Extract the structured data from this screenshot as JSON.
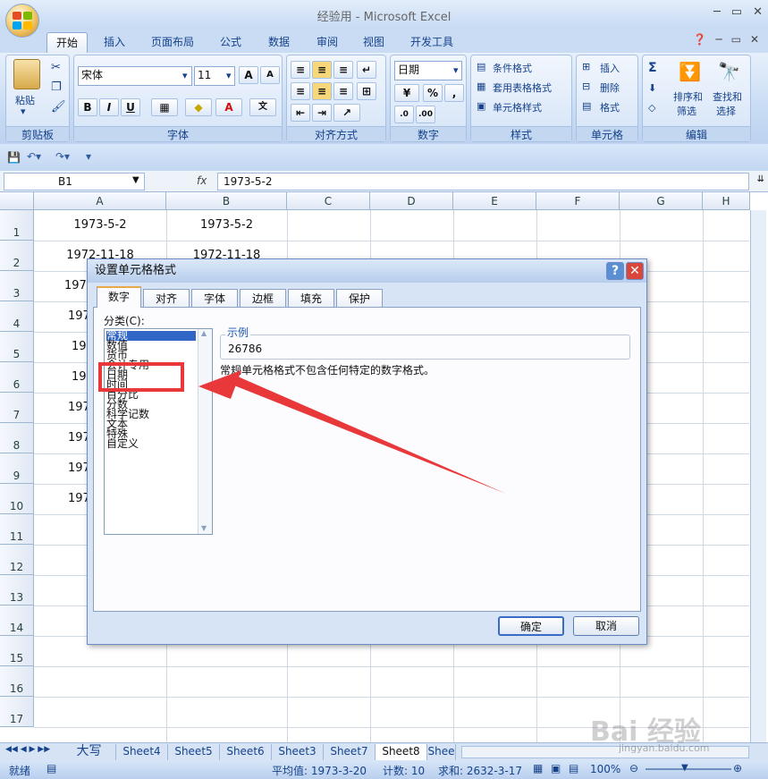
{
  "window": {
    "title": "经验用 - Microsoft Excel"
  },
  "ribbon_tabs": [
    "开始",
    "插入",
    "页面布局",
    "公式",
    "数据",
    "审阅",
    "视图",
    "开发工具"
  ],
  "ribbon": {
    "clipboard": {
      "paste": "粘贴",
      "label": "剪贴板"
    },
    "font": {
      "name": "宋体",
      "size": "11",
      "label": "字体",
      "bold": "B",
      "italic": "I",
      "underline": "U",
      "grow": "A",
      "shrink": "A",
      "color": "A"
    },
    "align": {
      "label": "对齐方式"
    },
    "number": {
      "format": "日期",
      "percent": "%",
      "comma": ",",
      "label": "数字"
    },
    "styles": {
      "cond": "条件格式",
      "table": "套用表格格式",
      "cell": "单元格样式",
      "label": "样式"
    },
    "cells": {
      "insert": "插入",
      "delete": "删除",
      "format": "格式",
      "label": "单元格"
    },
    "edit": {
      "sort_l1": "排序和",
      "sort_l2": "筛选",
      "find_l1": "查找和",
      "find_l2": "选择",
      "label": "编辑",
      "sum": "Σ"
    }
  },
  "formula_bar": {
    "name_box": "B1",
    "fx": "fx",
    "value": "1973-5-2"
  },
  "columns": [
    "A",
    "B",
    "C",
    "D",
    "E",
    "F",
    "G",
    "H"
  ],
  "rows": [
    "1",
    "2",
    "3",
    "4",
    "5",
    "6",
    "7",
    "8",
    "9",
    "10",
    "11",
    "12",
    "13",
    "14",
    "15",
    "16",
    "17"
  ],
  "cells": {
    "a1": "1973-5-2",
    "b1": "1973-5-2",
    "a2": "1972-11-18",
    "b2": "1972-11-18",
    "a3": "197",
    "a4": "197",
    "a5": "19",
    "a6": "19",
    "a7": "197",
    "a8": "197",
    "a9": "197",
    "a10": "197"
  },
  "dialog": {
    "title": "设置单元格格式",
    "tabs": [
      "数字",
      "对齐",
      "字体",
      "边框",
      "填充",
      "保护"
    ],
    "category_label": "分类(C):",
    "categories": [
      "常规",
      "数值",
      "货币",
      "会计专用",
      "日期",
      "时间",
      "百分比",
      "分数",
      "科学记数",
      "文本",
      "特殊",
      "自定义"
    ],
    "sample_label": "示例",
    "sample_value": "26786",
    "description": "常规单元格格式不包含任何特定的数字格式。",
    "ok": "确定",
    "cancel": "取消",
    "help": "?",
    "close": "✕"
  },
  "sheet_tabs": [
    "大写",
    "Sheet4",
    "Sheet5",
    "Sheet6",
    "Sheet3",
    "Sheet7",
    "Sheet8",
    "Shee"
  ],
  "status": {
    "ready": "就绪",
    "average": "平均值: 1973-3-20",
    "count": "计数: 10",
    "sum": "求和: 2632-3-17",
    "zoom": "100%"
  },
  "watermark": {
    "main": "Bai 经验",
    "sub": "jingyan.baidu.com"
  },
  "colors": {
    "highlight": "#e8383a",
    "selection": "#3166c6",
    "ribbon_blue": "#15428b"
  }
}
